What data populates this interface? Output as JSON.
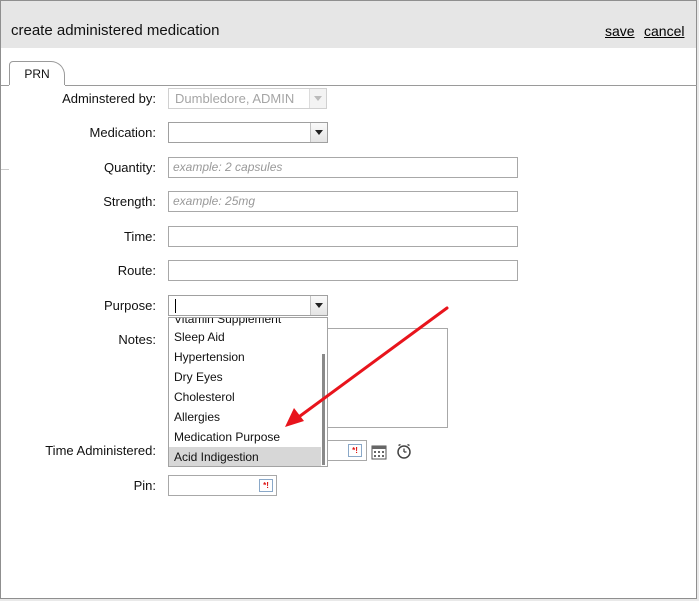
{
  "dialog": {
    "title": "create administered medication",
    "save_label": "save",
    "cancel_label": "cancel"
  },
  "tabs": [
    {
      "label": "PRN",
      "active": true
    }
  ],
  "form": {
    "administered_by": {
      "label": "Adminstered by:",
      "value": "Dumbledore, ADMIN",
      "disabled": true
    },
    "medication": {
      "label": "Medication:",
      "value": ""
    },
    "quantity": {
      "label": "Quantity:",
      "value": "",
      "placeholder": "example: 2 capsules"
    },
    "strength": {
      "label": "Strength:",
      "value": "",
      "placeholder": "example: 25mg"
    },
    "time": {
      "label": "Time:",
      "value": ""
    },
    "route": {
      "label": "Route:",
      "value": ""
    },
    "purpose": {
      "label": "Purpose:",
      "value": ""
    },
    "notes": {
      "label": "Notes:",
      "value": ""
    },
    "time_administered": {
      "label": "Time Administered:",
      "value": ""
    },
    "pin": {
      "label": "Pin:",
      "value": ""
    }
  },
  "purpose_dropdown": {
    "items": [
      "Vitamin Supplement",
      "Sleep Aid",
      "Hypertension",
      "Dry Eyes",
      "Cholesterol",
      "Allergies",
      "Medication Purpose",
      "Acid Indigestion"
    ],
    "selected": "Acid Indigestion"
  },
  "annotation": {
    "arrow_color": "#e8141c"
  },
  "icons": {
    "calendar": "calendar-icon",
    "clock": "clock-icon",
    "field_tip": "field-tip-icon"
  }
}
